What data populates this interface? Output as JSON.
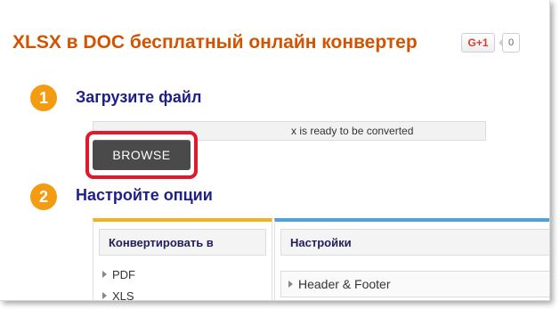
{
  "header": {
    "title": "XLSX в DOC бесплатный онлайн конвертер",
    "gplus_label": "G+1",
    "gplus_count": "0"
  },
  "steps": [
    {
      "number": "1",
      "title": "Загрузите файл"
    },
    {
      "number": "2",
      "title": "Настройте опции"
    }
  ],
  "upload": {
    "status_text": "x is ready to be converted",
    "browse_label": "BROWSE"
  },
  "convert_panel": {
    "heading": "Конвертировать в",
    "formats": [
      "PDF",
      "XLS"
    ]
  },
  "settings_panel": {
    "heading": "Настройки",
    "items": [
      "Header & Footer"
    ]
  },
  "colors": {
    "title": "#d35400",
    "step_badge": "#f39c12",
    "step_title": "#1f1f8a",
    "highlight": "#e0192b",
    "panel_left_accent": "#f5b120",
    "panel_right_accent": "#4aa3df"
  }
}
